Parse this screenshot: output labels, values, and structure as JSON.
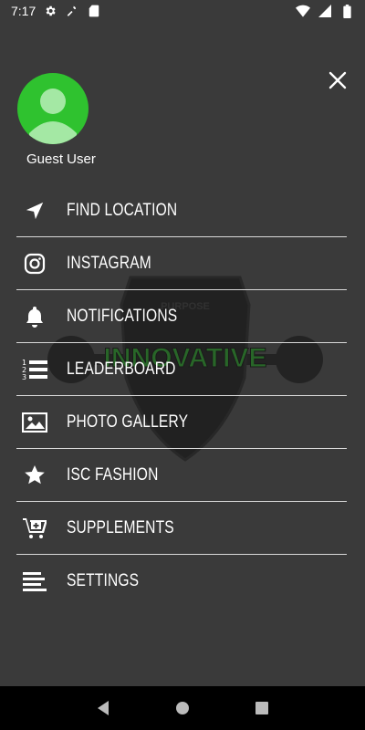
{
  "status_bar": {
    "time": "7:17",
    "left_icons": [
      "settings-icon",
      "wrench-icon",
      "sd-card-icon"
    ],
    "right_icons": [
      "wifi-icon",
      "signal-icon",
      "battery-icon"
    ]
  },
  "profile": {
    "name": "Guest User",
    "avatar_color": "#2fc22f"
  },
  "close_icon": "close-icon",
  "background_logo": {
    "top_text": "PURPOSE",
    "main_text": "INNOVATIVE",
    "accent": "#1a8a1a"
  },
  "menu": [
    {
      "label": "FIND LOCATION",
      "icon": "navigation-arrow-icon"
    },
    {
      "label": "INSTAGRAM",
      "icon": "instagram-icon"
    },
    {
      "label": "NOTIFICATIONS",
      "icon": "bell-icon"
    },
    {
      "label": "LEADERBOARD",
      "icon": "numbered-list-icon"
    },
    {
      "label": "PHOTO GALLERY",
      "icon": "photo-icon"
    },
    {
      "label": "ISC FASHION",
      "icon": "star-icon"
    },
    {
      "label": "SUPPLEMENTS",
      "icon": "cart-add-icon"
    },
    {
      "label": "SETTINGS",
      "icon": "lines-icon"
    }
  ],
  "nav_bar": {
    "buttons": [
      "back-icon",
      "home-icon",
      "recents-icon"
    ]
  }
}
